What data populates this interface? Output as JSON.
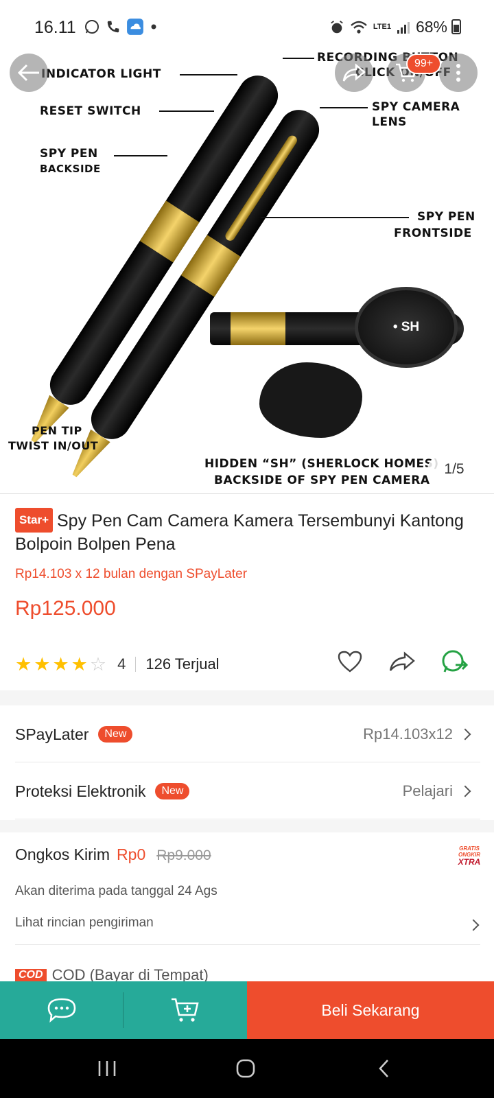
{
  "status_bar": {
    "time": "16.11",
    "network": "LTE1",
    "battery": "68%",
    "icons": [
      "whatsapp-icon",
      "phone-icon",
      "cloud-upload-icon",
      "dot-icon",
      "alarm-icon",
      "wifi-icon",
      "signal-icon",
      "battery-icon"
    ]
  },
  "image": {
    "labels": {
      "indicator": "INDICATOR LIGHT",
      "reset": "RESET SWITCH",
      "backside_1": "SPY PEN",
      "backside_2": "BACKSIDE",
      "recording_1": "RECORDING BUTTON",
      "recording_2": "CLICK ON/OFF",
      "camera_1": "SPY CAMERA",
      "camera_2": "LENS",
      "frontside_1": "SPY PEN",
      "frontside_2": "FRONTSIDE",
      "tip_1": "PEN TIP",
      "tip_2": "TWIST IN/OUT",
      "magnifier": "• SH",
      "hidden_1": "HIDDEN “SH” (SHERLOCK HOMES)",
      "hidden_2": "BACKSIDE OF SPY PEN CAMERA"
    },
    "counter": "1/5",
    "cart_badge": "99+"
  },
  "product": {
    "badge": "Star+",
    "title": "Spy Pen Cam Camera Kamera Tersembunyi Kantong Bolpoin Bolpen Pena",
    "paylater_info": "Rp14.103 x 12 bulan dengan SPayLater",
    "price": "Rp125.000",
    "rating": "4",
    "rating_value": 4,
    "rating_max": 5,
    "sold": "126 Terjual"
  },
  "options": {
    "spaylater_label": "SPayLater",
    "spaylater_badge": "New",
    "spaylater_value": "Rp14.103x12",
    "protection_label": "Proteksi Elektronik",
    "protection_badge": "New",
    "protection_value": "Pelajari"
  },
  "shipping": {
    "label": "Ongkos Kirim",
    "price": "Rp0",
    "original": "Rp9.000",
    "badge_1": "GRATIS",
    "badge_2": "ONGKIR",
    "badge_3": "XTRA",
    "delivery_text": "Akan diterima pada tanggal 24 Ags",
    "detail_link": "Lihat rincian pengiriman",
    "cod_badge": "COD",
    "cod_label": "COD (Bayar di Tempat)"
  },
  "bottom_bar": {
    "buy_label": "Beli Sekarang"
  },
  "colors": {
    "accent": "#ee4d2d",
    "teal": "#26aa99",
    "star": "#ffc000"
  }
}
